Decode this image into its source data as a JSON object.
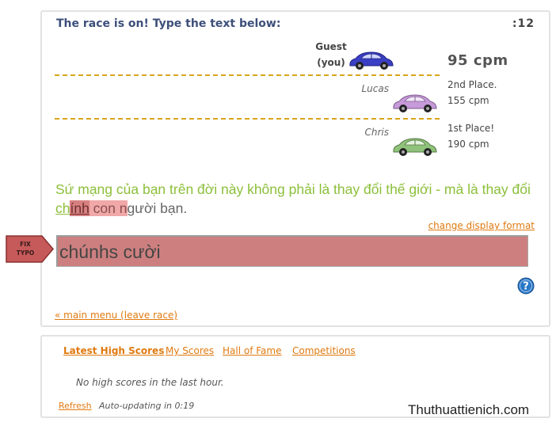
{
  "race": {
    "title": "The race is on! Type the text below:",
    "timer": ":12",
    "racers": [
      {
        "name_line1": "Guest",
        "name_line2": "(you)",
        "car_color": "#3a3fc4",
        "speed": "95 cpm",
        "is_you": true
      },
      {
        "name": "Lucas",
        "car_color": "#c79ad9",
        "place": "2nd Place.",
        "speed": "155 cpm"
      },
      {
        "name": "Chris",
        "car_color": "#8fc27a",
        "place": "1st Place!",
        "speed": "190 cpm"
      }
    ],
    "text": {
      "typed": "Sứ mạng của bạn trên đời này không phải là thay đổi thế giới - mà là thay đổi ch",
      "error_current": "ính",
      "error_rest": " con n",
      "untyped": "gười bạn."
    },
    "change_format": "change display format",
    "input_value": "chúnhs cười",
    "fix_typo_line1": "FIX",
    "fix_typo_line2": "TYPO",
    "main_menu": "« main menu (leave race)",
    "help_icon": "help-question-icon"
  },
  "scores": {
    "tabs": [
      "Latest High Scores",
      "My Scores",
      "Hall of Fame",
      "Competitions"
    ],
    "empty_message": "No high scores in the last hour.",
    "refresh": "Refresh",
    "auto_update": "Auto-updating in 0:19"
  },
  "watermark": "Thuthuattienich.com",
  "colors": {
    "accent_link": "#e07a10",
    "lane_line": "#d8a417",
    "text_correct": "#8cbf3a",
    "input_error_bg": "#cd7f7f",
    "title": "#3d4f7a"
  }
}
